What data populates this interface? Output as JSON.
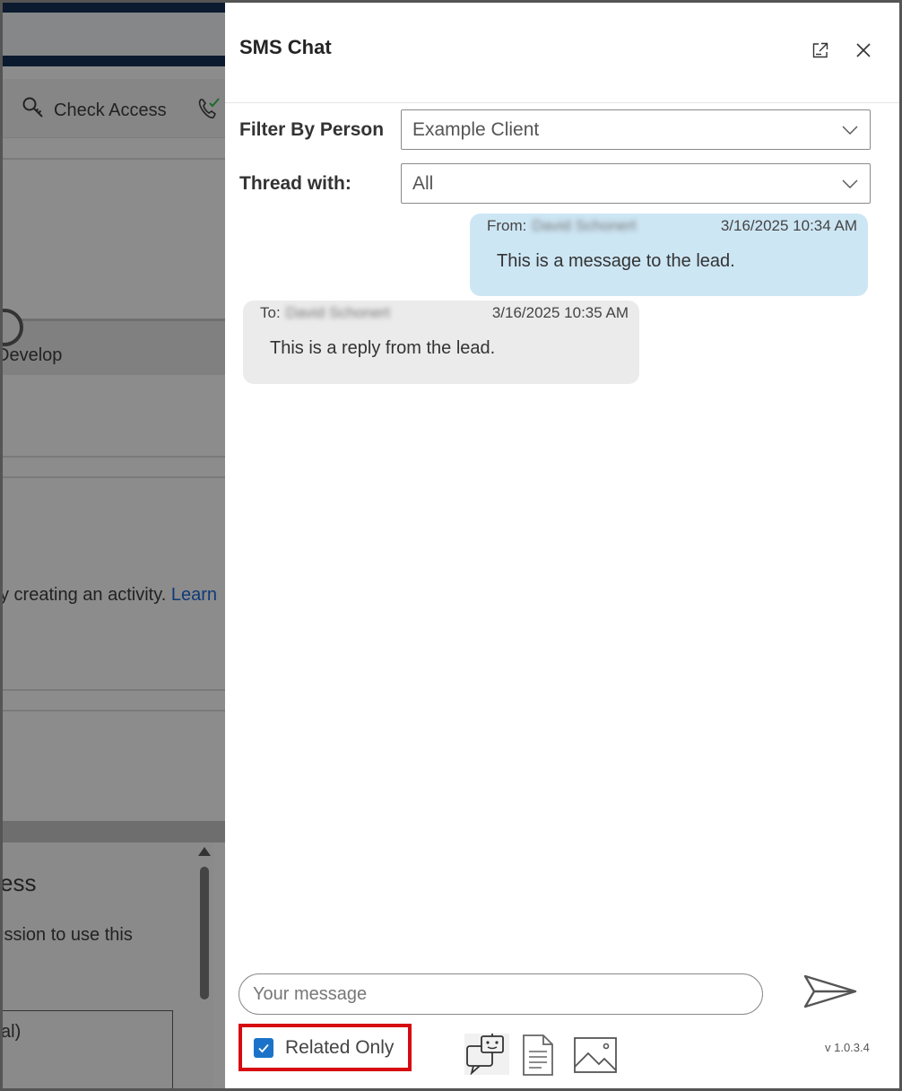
{
  "background_app": {
    "check_access_label": "Check Access",
    "stage_label": "Develop",
    "activity_text": "y creating an activity.",
    "activity_link": "Learn",
    "dialog_title": "ess",
    "dialog_message": "ission to use this",
    "dialog_field": "al)"
  },
  "panel": {
    "title": "SMS Chat",
    "filter_label": "Filter By Person",
    "filter_value": "Example Client",
    "thread_label": "Thread with:",
    "thread_value": "All"
  },
  "messages": [
    {
      "direction": "From:",
      "contact": "David Schonert",
      "timestamp": "3/16/2025 10:34 AM",
      "text": "This is a message to the lead."
    },
    {
      "direction": "To:",
      "contact": "David Schonert",
      "timestamp": "3/16/2025 10:35 AM",
      "text": "This is a reply from the lead."
    }
  ],
  "composer": {
    "placeholder": "Your message"
  },
  "footer": {
    "related_only_label": "Related Only",
    "related_only_checked": true,
    "version": "v 1.0.3.4"
  },
  "icons": {
    "popout": "popout-icon",
    "close": "close-icon",
    "send": "send-icon",
    "bot": "chatbot-icon",
    "document": "document-icon",
    "image": "image-icon"
  },
  "colors": {
    "outgoing_bubble": "#cde6f4",
    "incoming_bubble": "#ebebeb",
    "checkbox": "#1a73c8",
    "highlight_border": "#d60a10"
  }
}
